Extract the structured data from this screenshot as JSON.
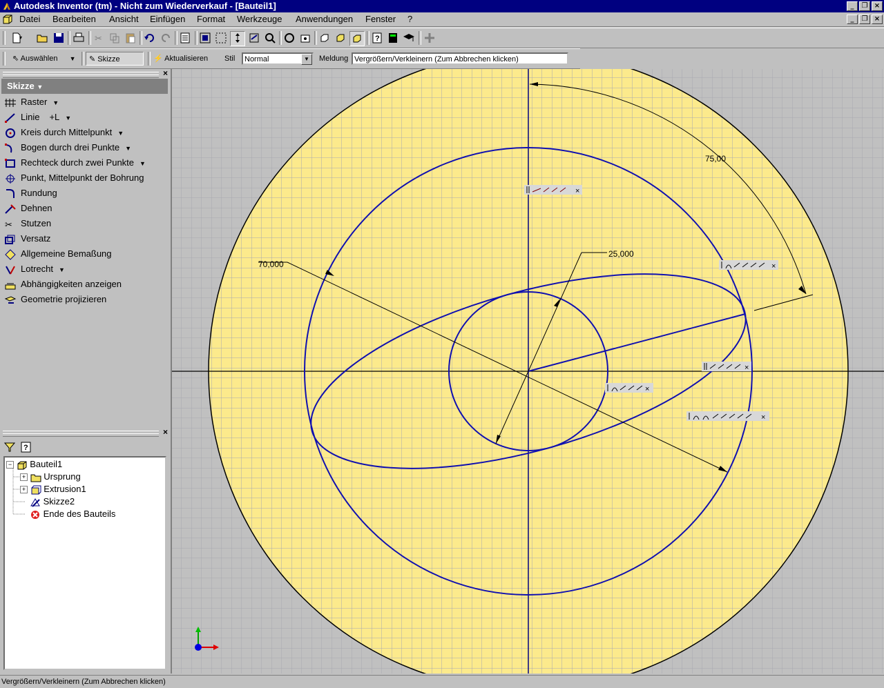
{
  "window": {
    "title": "Autodesk Inventor (tm) - Nicht zum Wiederverkauf - [Bauteil1]"
  },
  "menu": [
    "Datei",
    "Bearbeiten",
    "Ansicht",
    "Einfügen",
    "Format",
    "Werkzeuge",
    "Anwendungen",
    "Fenster",
    "?"
  ],
  "toolbar2": {
    "select_label": "Auswählen",
    "sketch_label": "Skizze",
    "update_label": "Aktualisieren",
    "style_label": "Stil",
    "style_value": "Normal",
    "message_label": "Meldung",
    "message_value": "Vergrößern/Verkleinern (Zum Abbrechen klicken)"
  },
  "panel": {
    "title": "Skizze",
    "commands": [
      {
        "label": "Raster",
        "icon": "grid-icon"
      },
      {
        "label": "Linie",
        "shortcut": "+L",
        "icon": "line-icon"
      },
      {
        "label": "Kreis durch Mittelpunkt",
        "icon": "circle-icon"
      },
      {
        "label": "Bogen durch drei Punkte",
        "icon": "arc-icon"
      },
      {
        "label": "Rechteck durch zwei Punkte",
        "icon": "rectangle-icon"
      },
      {
        "label": "Punkt, Mittelpunkt der Bohrung",
        "icon": "point-icon"
      },
      {
        "label": "Rundung",
        "icon": "fillet-icon"
      },
      {
        "label": "Dehnen",
        "icon": "extend-icon"
      },
      {
        "label": "Stutzen",
        "icon": "trim-icon"
      },
      {
        "label": "Versatz",
        "icon": "offset-icon"
      },
      {
        "label": "Allgemeine Bemaßung",
        "icon": "dimension-icon"
      },
      {
        "label": "Lotrecht",
        "icon": "perpendicular-icon"
      },
      {
        "label": "Abhängigkeiten anzeigen",
        "icon": "constraints-icon"
      },
      {
        "label": "Geometrie projizieren",
        "icon": "project-icon"
      }
    ]
  },
  "browser": {
    "nodes": [
      {
        "label": "Bauteil1"
      },
      {
        "label": "Ursprung"
      },
      {
        "label": "Extrusion1"
      },
      {
        "label": "Skizze2"
      },
      {
        "label": "Ende des Bauteils"
      }
    ]
  },
  "sketch": {
    "dim_angle": "75,00",
    "dim_radius": "25,000",
    "dim_diameter": "70,000"
  },
  "status": "Vergrößern/Verkleinern (Zum Abbrechen klicken)"
}
